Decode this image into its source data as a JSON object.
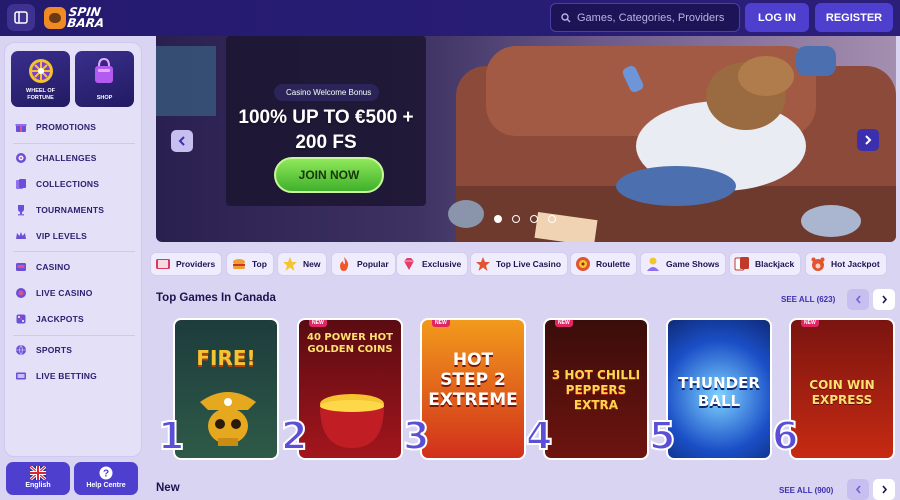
{
  "header": {
    "logo_text_top": "SPIN",
    "logo_text_bottom": "BARA",
    "search_placeholder": "Games, Categories, Providers",
    "login_label": "LOG IN",
    "register_label": "REGISTER"
  },
  "sidebar": {
    "tiles": [
      {
        "label": "WHEEL OF FORTUNE"
      },
      {
        "label": "SHOP"
      }
    ],
    "items": [
      {
        "label": "PROMOTIONS",
        "icon": "gift-icon"
      },
      {
        "label": "CHALLENGES",
        "icon": "target-icon"
      },
      {
        "label": "COLLECTIONS",
        "icon": "cards-icon"
      },
      {
        "label": "TOURNAMENTS",
        "icon": "trophy-icon"
      },
      {
        "label": "VIP LEVELS",
        "icon": "crown-icon"
      },
      {
        "label": "CASINO",
        "icon": "slot-icon"
      },
      {
        "label": "LIVE CASINO",
        "icon": "chip-icon"
      },
      {
        "label": "JACKPOTS",
        "icon": "dice-icon"
      },
      {
        "label": "SPORTS",
        "icon": "ball-icon"
      },
      {
        "label": "LIVE BETTING",
        "icon": "screen-icon"
      }
    ],
    "language_label": "English",
    "help_label": "Help Centre"
  },
  "banner": {
    "badge": "Casino Welcome Bonus",
    "headline_line1": "100% UP TO €500 +",
    "headline_line2": "200 FS",
    "cta_label": "JOIN NOW",
    "slide_count": 4,
    "active_slide": 1
  },
  "categories": [
    {
      "label": "Providers",
      "icon": "book-icon"
    },
    {
      "label": "Top",
      "icon": "burger-icon"
    },
    {
      "label": "New",
      "icon": "star-icon"
    },
    {
      "label": "Popular",
      "icon": "fire-icon"
    },
    {
      "label": "Exclusive",
      "icon": "gem-icon"
    },
    {
      "label": "Top Live Casino",
      "icon": "star-icon"
    },
    {
      "label": "Roulette",
      "icon": "roulette-icon"
    },
    {
      "label": "Game Shows",
      "icon": "host-icon"
    },
    {
      "label": "Blackjack",
      "icon": "cards-icon"
    },
    {
      "label": "Hot Jackpot",
      "icon": "bear-icon"
    }
  ],
  "top_games": {
    "title": "Top Games In Canada",
    "see_all": "SEE ALL (623)",
    "games": [
      {
        "rank": "1",
        "name": "FIRE!",
        "badge": ""
      },
      {
        "rank": "2",
        "name": "40 POWER HOT GOLDEN COINS",
        "badge": "NEW"
      },
      {
        "rank": "3",
        "name": "HOT STEP 2 EXTREME",
        "badge": "NEW"
      },
      {
        "rank": "4",
        "name": "3 HOT CHILLI PEPPERS EXTRA",
        "badge": "NEW"
      },
      {
        "rank": "5",
        "name": "THUNDER BALL",
        "badge": ""
      },
      {
        "rank": "6",
        "name": "COIN WIN EXPRESS",
        "badge": "NEW"
      }
    ]
  },
  "new_section": {
    "title": "New",
    "see_all": "SEE ALL (900)"
  },
  "colors": {
    "header_bg": "#241a6e",
    "accent_button": "#4f3fcf",
    "page_bg": "#d9d4f2",
    "cta_green": "#5dcf3a"
  }
}
